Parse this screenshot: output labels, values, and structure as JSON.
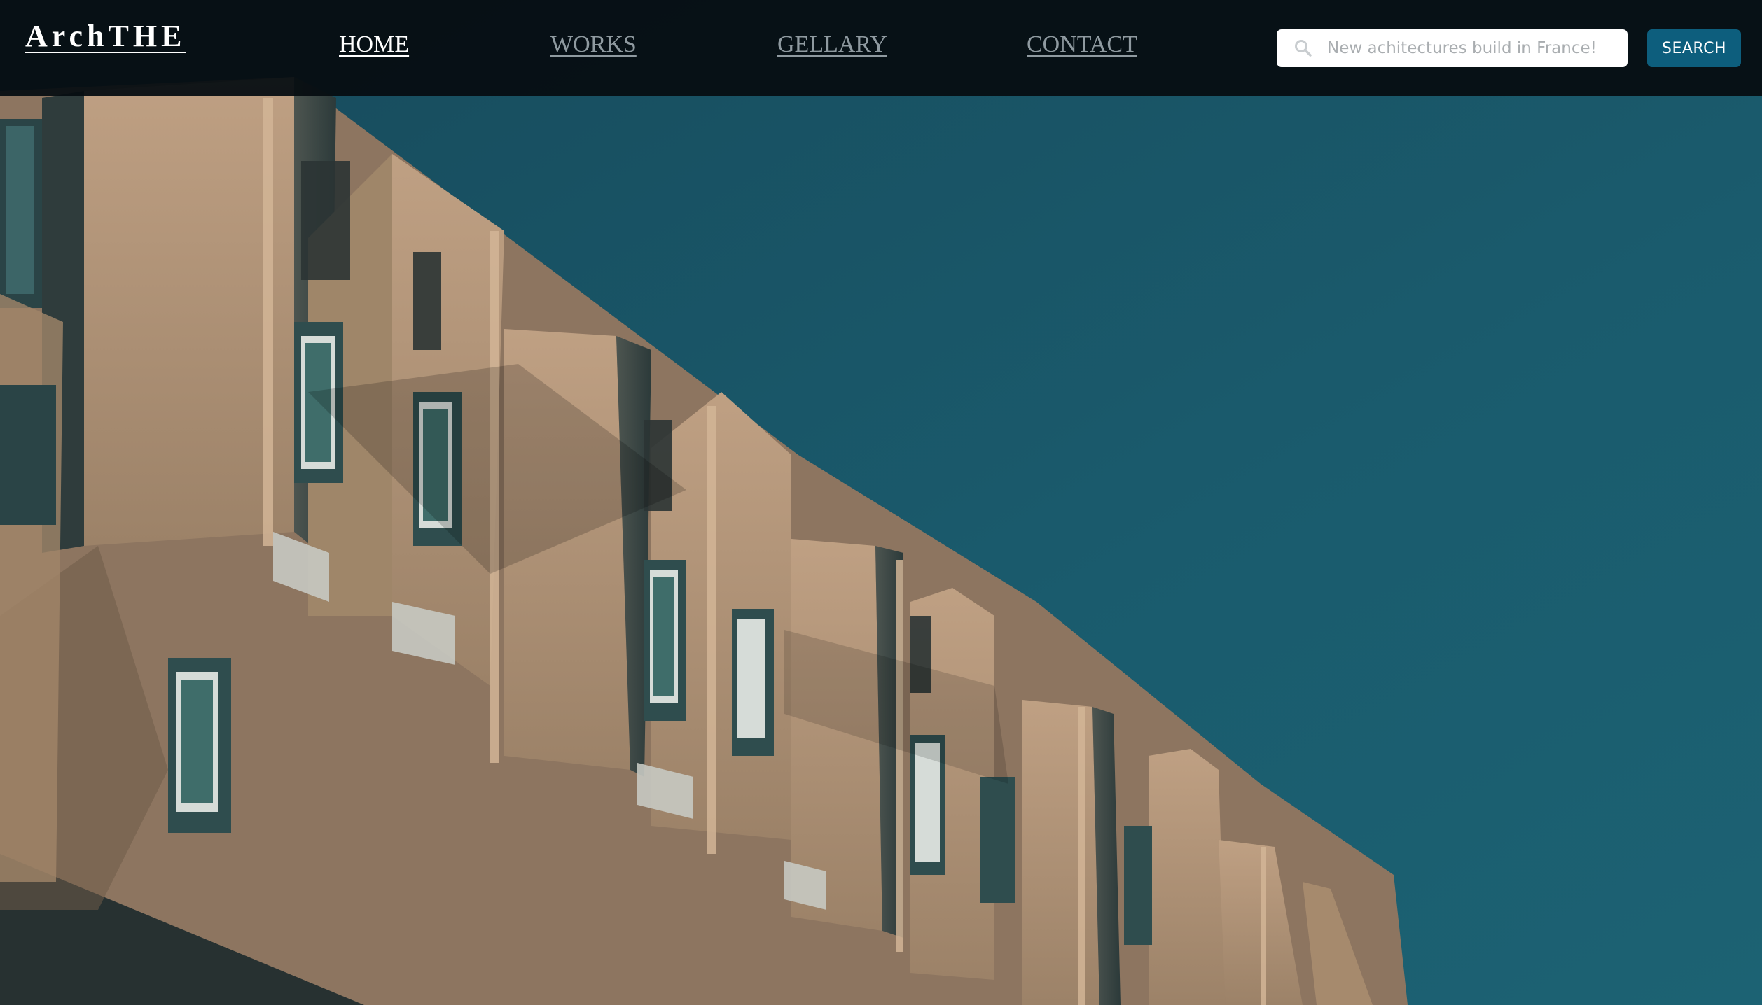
{
  "header": {
    "logo_text": "ArchTHE",
    "nav": [
      {
        "label": "HOME",
        "active": true
      },
      {
        "label": "WORKS",
        "active": false
      },
      {
        "label": "GELLARY",
        "active": false
      },
      {
        "label": "CONTACT",
        "active": false
      }
    ],
    "search": {
      "placeholder": "New achitectures build in France!",
      "value": "",
      "icon": "search-icon",
      "button_label": "SEARCH"
    }
  },
  "hero": {
    "image_subject": "building-facade-photo"
  },
  "colors": {
    "navbar_bg": "#060d11",
    "sky": "#1a5a6c",
    "facade": "#b99c7f",
    "button_accent": "#0d5e7d",
    "nav_active": "#ffffff",
    "nav_inactive": "#8f9aa0"
  }
}
